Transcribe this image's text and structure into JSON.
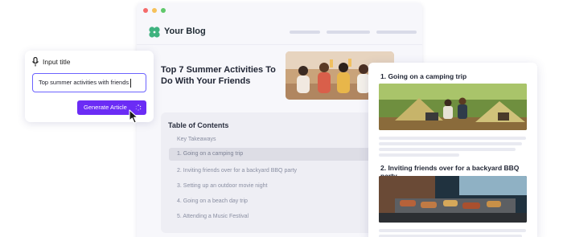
{
  "window_controls": {
    "close_color": "#f56a6a",
    "minimize_color": "#f6c15a",
    "maximize_color": "#5fc86a"
  },
  "blog": {
    "brand_name": "Your Blog",
    "logo_color": "#3fb27f",
    "headline": "Top 7 Summer Activities To Do With Your Friends",
    "toc": {
      "title": "Table of Contents",
      "items": [
        {
          "label": "Key Takeaways"
        },
        {
          "label": "1. Going on a camping trip",
          "active": true
        },
        {
          "label": "2. Inviting friends over for a backyard BBQ party"
        },
        {
          "label": "3. Setting up an outdoor movie night"
        },
        {
          "label": "4. Going on a beach day trip"
        },
        {
          "label": "5. Attending a Music Festival"
        }
      ]
    }
  },
  "input_card": {
    "label": "Input title",
    "icon": "microphone-icon",
    "value": "Top summer activities with friends",
    "button_label": "Generate Article",
    "accent": "#6b2cf5"
  },
  "article": {
    "sections": [
      {
        "title": "1. Going on a camping trip"
      },
      {
        "title": "2. Inviting friends over for a backyard BBQ party"
      }
    ]
  }
}
